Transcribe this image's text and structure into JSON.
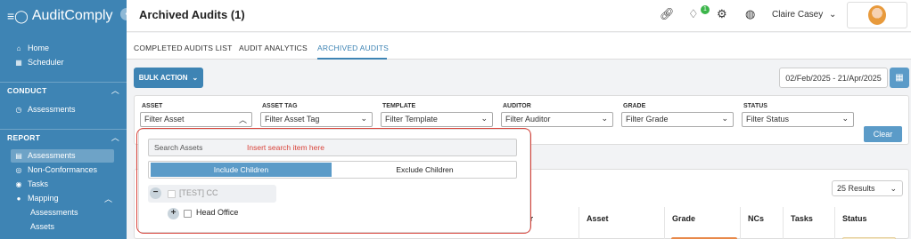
{
  "app": {
    "name": "AuditComply",
    "collapse_icon": "chevron-left-icon"
  },
  "sidebar": {
    "top_items": [
      {
        "label": "Home",
        "icon": "home-icon"
      },
      {
        "label": "Scheduler",
        "icon": "calendar-icon"
      }
    ],
    "sections": {
      "conduct": {
        "label": "CONDUCT",
        "items": [
          {
            "label": "Assessments",
            "icon": "clock-icon"
          }
        ]
      },
      "report": {
        "label": "REPORT",
        "items": [
          {
            "label": "Assessments",
            "icon": "list-icon",
            "active": true
          },
          {
            "label": "Non-Conformances",
            "icon": "nc-icon"
          },
          {
            "label": "Tasks",
            "icon": "target-icon"
          },
          {
            "label": "Mapping",
            "icon": "map-pin-icon"
          }
        ],
        "sub_items": [
          {
            "label": "Assessments"
          },
          {
            "label": "Assets"
          }
        ]
      }
    }
  },
  "header": {
    "title": "Archived Audits (1)",
    "notification_count": "1",
    "user_name": "Claire Casey",
    "icons": [
      "link-icon",
      "bell-icon",
      "gear-icon",
      "globe-icon"
    ]
  },
  "tabs": [
    {
      "label": "COMPLETED AUDITS LIST",
      "active": false
    },
    {
      "label": "AUDIT ANALYTICS",
      "active": false
    },
    {
      "label": "ARCHIVED AUDITS",
      "active": true
    }
  ],
  "toolbar": {
    "bulk_action_label": "BULK ACTION",
    "date_range": "02/Feb/2025 - 21/Apr/2025"
  },
  "filters": [
    {
      "label": "ASSET",
      "placeholder": "Filter Asset",
      "open": true
    },
    {
      "label": "ASSET TAG",
      "placeholder": "Filter Asset Tag"
    },
    {
      "label": "TEMPLATE",
      "placeholder": "Filter Template"
    },
    {
      "label": "AUDITOR",
      "placeholder": "Filter Auditor"
    },
    {
      "label": "GRADE",
      "placeholder": "Filter Grade"
    },
    {
      "label": "STATUS",
      "placeholder": "Filter Status"
    }
  ],
  "clear_label": "Clear",
  "asset_dropdown": {
    "search_placeholder": "Search Assets",
    "search_hint": "Insert search item here",
    "include_children_label": "Include Children",
    "exclude_children_label": "Exclude Children",
    "tree": [
      {
        "label": "[TEST] CC",
        "expanded": true,
        "disabled": true
      },
      {
        "label": "Head Office",
        "expanded": false
      }
    ]
  },
  "table": {
    "results_per_page": "25 Results",
    "partial_header_fragment": "or",
    "columns": [
      "Asset",
      "Grade",
      "NCs",
      "Tasks",
      "Status"
    ]
  },
  "colors": {
    "primary": "#3e84b4",
    "accent_button": "#5b9bc8",
    "success_badge": "#3bb54a",
    "annotation_red": "#d9433a"
  }
}
